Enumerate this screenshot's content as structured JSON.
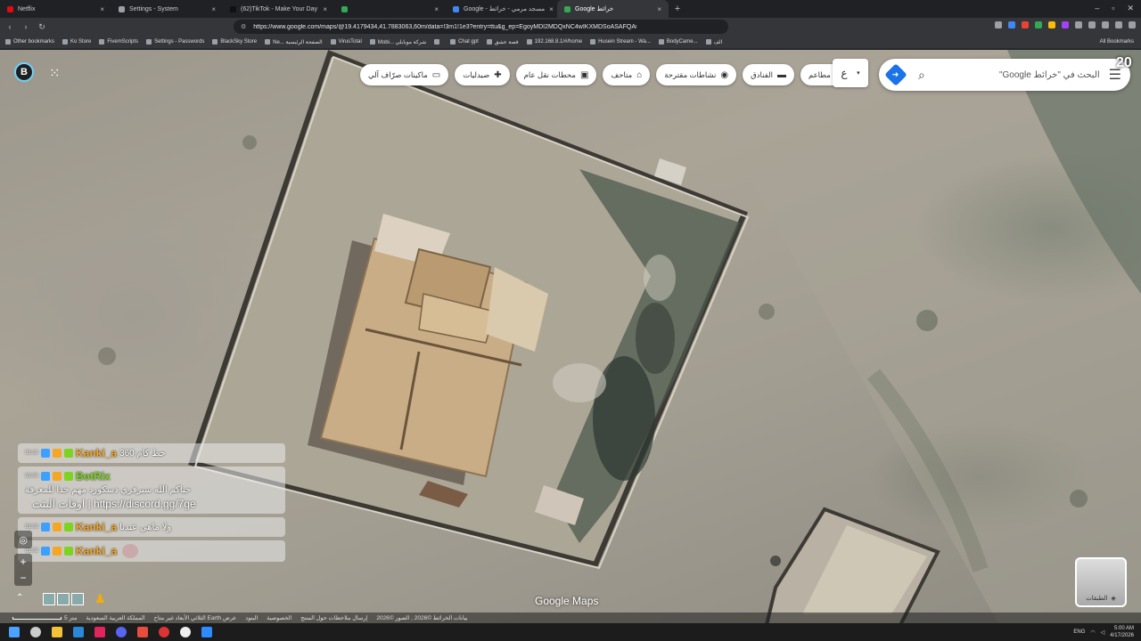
{
  "browser": {
    "tabs": [
      {
        "title": "Netflix",
        "color": "#e50914"
      },
      {
        "title": "Settings - System",
        "color": "#9aa0a6"
      },
      {
        "title": "(62)TikTok - Make Your Day",
        "color": "#111111"
      },
      {
        "title": "",
        "color": "#34a853"
      },
      {
        "title": "Google - مسجد مرمي - خرائط",
        "color": "#4285f4"
      },
      {
        "title": "Google خرائط",
        "color": "#34a853",
        "active": true
      }
    ],
    "new_tab": "+",
    "url": "https://www.google.com/maps/@19.4179434,41.7883063,60m/data=!3m1!1e3?entry=ttu&g_ep=EgoyMDI2MDQxNC4wIKXMDSoASAFQAw%3D%3D",
    "bookmarks": [
      "Other bookmarks",
      "Ko Store",
      "FivemScripts",
      "Settings - Passwords",
      "BlackSky Store",
      "Ne... الصفحة الرئيسية",
      "VirusTotal",
      "Mobi... شركة موبايلي",
      "",
      "Chat gpt",
      "قصة عشق",
      "192.168.8.1/#/home",
      "Husein Stream - Wa...",
      "BodyCame...",
      "الف"
    ],
    "all_bookmarks": "All Bookmarks"
  },
  "maps": {
    "search_placeholder": "البحث في \"خرائط Google\"",
    "language_button": "ع",
    "chips": [
      {
        "label": "ماكينات صرّاف آلي",
        "icon": "atm-icon",
        "glyph": "▭"
      },
      {
        "label": "صيدليات",
        "icon": "pharmacy-icon",
        "glyph": "✚"
      },
      {
        "label": "محطات نقل عام",
        "icon": "transit-icon",
        "glyph": "▣"
      },
      {
        "label": "متاحف",
        "icon": "museum-icon",
        "glyph": "⌂"
      },
      {
        "label": "نشاطات مقترحة",
        "icon": "camera-icon",
        "glyph": "◉"
      },
      {
        "label": "الفنادق",
        "icon": "hotel-icon",
        "glyph": "▬"
      },
      {
        "label": "مطاعم",
        "icon": "restaurant-icon",
        "glyph": "✕"
      }
    ],
    "watermark": "Google Maps",
    "layers_label": "الطبقات",
    "footer": {
      "scale": "5 متر",
      "links": [
        "إرسال ملاحظات حول المنتج",
        "الخصوصية",
        "البنود",
        "عرض Earth الثلاثي الأبعاد غير متاح",
        "المملكة العربية السعودية"
      ],
      "attribution": "بيانات الخرائط ©2026 , الصور ©2026"
    }
  },
  "chat": [
    {
      "time": "05:00",
      "user": "Kanki_a",
      "user_color": "#f5a623",
      "text": "حط كام 360"
    },
    {
      "time": "05:00",
      "user": "BotRix",
      "user_color": "#7ed321",
      "text": "حياكم الله سيرفري دسكورد مهم جدا للمعرفة",
      "text2": "اوقات البثث | https://discord.gg/7ge"
    },
    {
      "time": "05:00",
      "user": "Kanki_a",
      "user_color": "#f5a623",
      "text": "ولا ماهي عندنا"
    },
    {
      "time": "05:00",
      "user": "Kanki_a",
      "user_color": "#f5a623",
      "text": ""
    }
  ],
  "overlay": {
    "app_icon": "B",
    "apps_glyph": "⋮⋮⋮",
    "corner_badge": "20"
  },
  "taskbar": {
    "lang": "ENG",
    "time": "5:00 AM",
    "date": "4/17/2026"
  }
}
